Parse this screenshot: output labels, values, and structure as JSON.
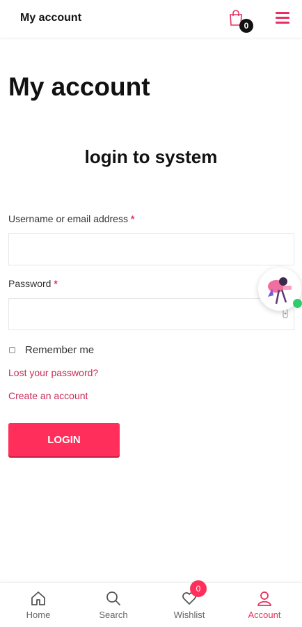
{
  "header": {
    "title": "My account",
    "cart_count": "0",
    "cart_icon": "shopping-bag-icon",
    "menu_icon": "hamburger-menu-icon"
  },
  "page": {
    "title": "My account",
    "section_title": "login to system"
  },
  "form": {
    "username_label": "Username or email address",
    "username_value": "",
    "password_label": "Password",
    "password_value": "",
    "required_mark": "*",
    "remember_label": "Remember me",
    "remember_checked": false,
    "lost_password": "Lost your password?",
    "create_account": "Create an account",
    "login_button": "LOGIN"
  },
  "chat": {
    "icon": "chat-avatar-icon",
    "status": "online"
  },
  "bottom_nav": {
    "items": [
      {
        "label": "Home",
        "icon": "home-icon"
      },
      {
        "label": "Search",
        "icon": "search-icon"
      },
      {
        "label": "Wishlist",
        "icon": "heart-icon",
        "badge": "0"
      },
      {
        "label": "Account",
        "icon": "user-icon",
        "active": true
      }
    ]
  },
  "colors": {
    "accent": "#ff2e5b",
    "link": "#c92b57",
    "online": "#2ecc71"
  }
}
